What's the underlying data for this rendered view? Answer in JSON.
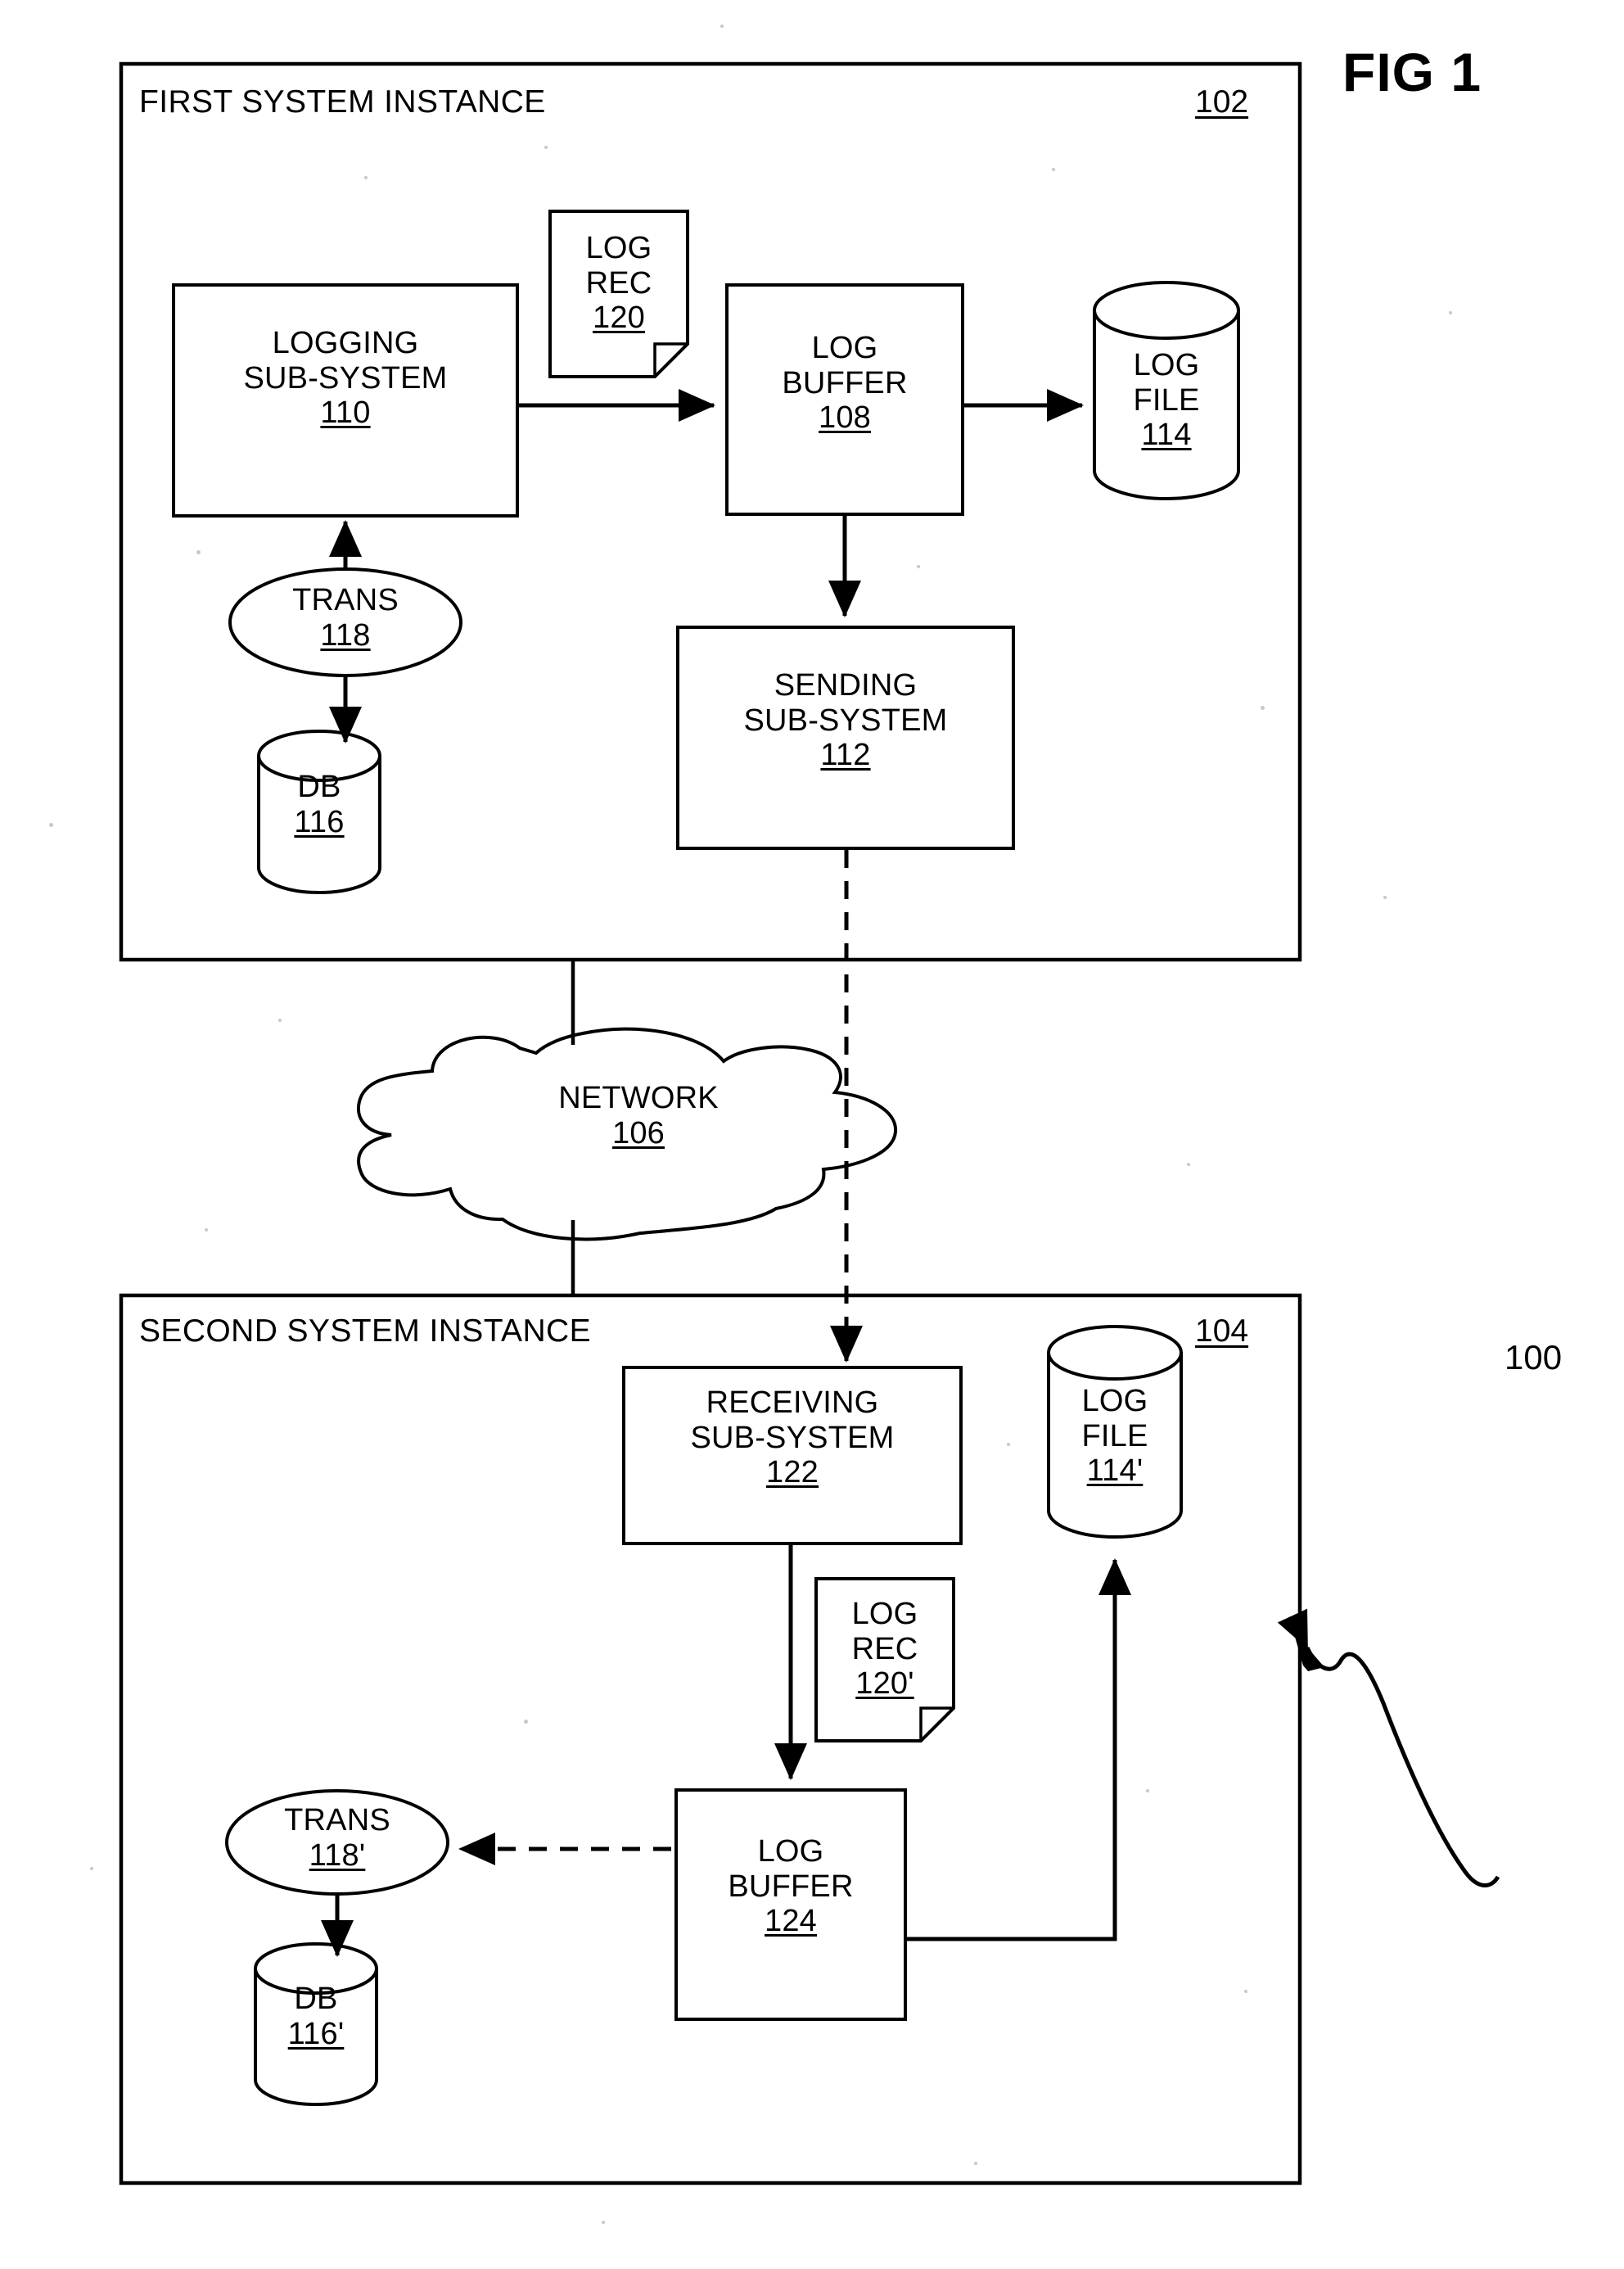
{
  "figure": {
    "title": "FIG 1",
    "overall_ref": "100"
  },
  "first_instance": {
    "title": "FIRST SYSTEM INSTANCE",
    "ref": "102",
    "nodes": {
      "logging_subsystem": {
        "line1": "LOGGING",
        "line2": "SUB-SYSTEM",
        "ref": "110",
        "shape": "rectangle"
      },
      "log_rec": {
        "line1": "LOG",
        "line2": "REC",
        "ref": "120",
        "shape": "document"
      },
      "log_buffer": {
        "line1": "LOG",
        "line2": "BUFFER",
        "ref": "108",
        "shape": "rectangle"
      },
      "log_file": {
        "line1": "LOG",
        "line2": "FILE",
        "ref": "114",
        "shape": "cylinder"
      },
      "trans": {
        "line1": "TRANS",
        "ref": "118",
        "shape": "ellipse"
      },
      "db": {
        "line1": "DB",
        "ref": "116",
        "shape": "cylinder"
      },
      "sending_subsystem": {
        "line1": "SENDING",
        "line2": "SUB-SYSTEM",
        "ref": "112",
        "shape": "rectangle"
      }
    }
  },
  "network": {
    "label": "NETWORK",
    "ref": "106",
    "shape": "cloud"
  },
  "second_instance": {
    "title": "SECOND SYSTEM INSTANCE",
    "ref": "104",
    "nodes": {
      "receiving_subsystem": {
        "line1": "RECEIVING",
        "line2": "SUB-SYSTEM",
        "ref": "122",
        "shape": "rectangle"
      },
      "log_file_prime": {
        "line1": "LOG",
        "line2": "FILE",
        "ref": "114'",
        "shape": "cylinder"
      },
      "log_rec_prime": {
        "line1": "LOG",
        "line2": "REC",
        "ref": "120'",
        "shape": "document"
      },
      "log_buffer_2": {
        "line1": "LOG",
        "line2": "BUFFER",
        "ref": "124",
        "shape": "rectangle"
      },
      "trans_prime": {
        "line1": "TRANS",
        "ref": "118'",
        "shape": "ellipse"
      },
      "db_prime": {
        "line1": "DB",
        "ref": "116'",
        "shape": "cylinder"
      }
    }
  },
  "colors": {
    "ink": "#000000",
    "paper": "#ffffff"
  }
}
